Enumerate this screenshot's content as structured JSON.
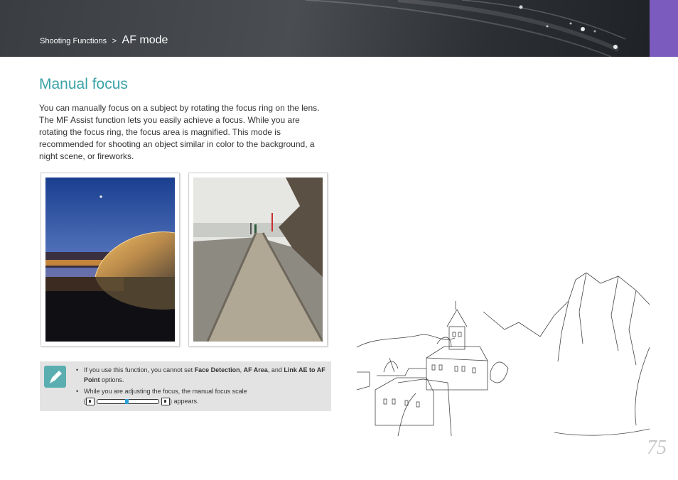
{
  "header": {
    "breadcrumb_section": "Shooting Functions",
    "breadcrumb_separator": ">",
    "breadcrumb_current": "AF mode"
  },
  "main": {
    "title": "Manual focus",
    "paragraph": "You can manually focus on a subject by rotating the focus ring on the lens. The MF Assist function lets you easily achieve a focus. While you are rotating the focus ring, the focus area is magnified. This mode is recommended for shooting an object similar in color to the background, a night scene, or fireworks."
  },
  "note": {
    "icon": "pencil-note-icon",
    "item1_text_a": "If you use this function, you cannot set ",
    "item1_bold_1": "Face Detection",
    "item1_text_b": ", ",
    "item1_bold_2": "AF Area",
    "item1_text_c": ", and ",
    "item1_bold_3": "Link AE to AF Point",
    "item1_text_d": " options.",
    "item2_text_a": "While you are adjusting the focus, the manual focus scale",
    "item2_text_b": ") appears.",
    "item2_paren_open": "(",
    "focus_scale_level": 0.48
  },
  "page_number": "75",
  "colors": {
    "title": "#3aa3a6",
    "header_bg": "#3a3d42",
    "side_tab": "#7b5bbd",
    "note_bg": "#e3e3e3",
    "note_icon_bg": "#5aaeb0",
    "scale_marker": "#2f9fd8"
  }
}
